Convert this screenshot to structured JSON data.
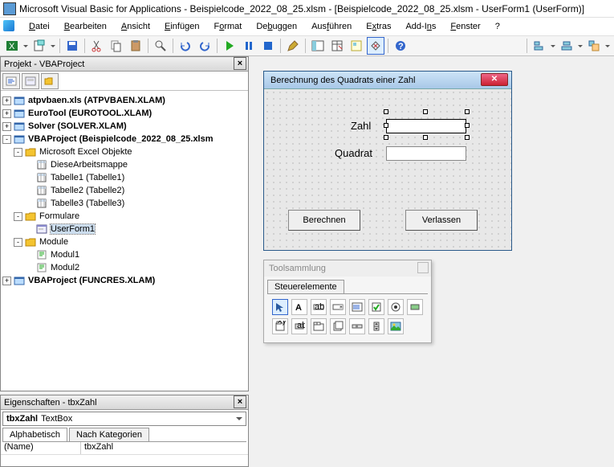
{
  "title": "Microsoft Visual Basic for Applications - Beispielcode_2022_08_25.xlsm - [Beispielcode_2022_08_25.xlsm - UserForm1 (UserForm)]",
  "menu": {
    "datei": "Datei",
    "bearbeiten": "Bearbeiten",
    "ansicht": "Ansicht",
    "einfuegen": "Einfügen",
    "format": "Format",
    "debuggen": "Debuggen",
    "ausfuehren": "Ausführen",
    "extras": "Extras",
    "addins": "Add-Ins",
    "fenster": "Fenster",
    "help": "?"
  },
  "project_panel": {
    "title": "Projekt - VBAProject",
    "items": [
      {
        "label": "atpvbaen.xls (ATPVBAEN.XLAM)",
        "bold": true,
        "exp": "+",
        "icon": "proj",
        "ind": 0
      },
      {
        "label": "EuroTool (EUROTOOL.XLAM)",
        "bold": true,
        "exp": "+",
        "icon": "proj",
        "ind": 0
      },
      {
        "label": "Solver (SOLVER.XLAM)",
        "bold": true,
        "exp": "+",
        "icon": "proj",
        "ind": 0
      },
      {
        "label": "VBAProject (Beispielcode_2022_08_25.xlsm",
        "bold": true,
        "exp": "-",
        "icon": "proj",
        "ind": 0
      },
      {
        "label": "Microsoft Excel Objekte",
        "bold": false,
        "exp": "-",
        "icon": "folder",
        "ind": 1
      },
      {
        "label": "DieseArbeitsmappe",
        "bold": false,
        "exp": "",
        "icon": "xls",
        "ind": 2
      },
      {
        "label": "Tabelle1 (Tabelle1)",
        "bold": false,
        "exp": "",
        "icon": "xls",
        "ind": 2
      },
      {
        "label": "Tabelle2 (Tabelle2)",
        "bold": false,
        "exp": "",
        "icon": "xls",
        "ind": 2
      },
      {
        "label": "Tabelle3 (Tabelle3)",
        "bold": false,
        "exp": "",
        "icon": "xls",
        "ind": 2
      },
      {
        "label": "Formulare",
        "bold": false,
        "exp": "-",
        "icon": "folder",
        "ind": 1
      },
      {
        "label": "UserForm1",
        "bold": false,
        "exp": "",
        "icon": "form",
        "ind": 2,
        "selected": true
      },
      {
        "label": "Module",
        "bold": false,
        "exp": "-",
        "icon": "folder",
        "ind": 1
      },
      {
        "label": "Modul1",
        "bold": false,
        "exp": "",
        "icon": "mod",
        "ind": 2
      },
      {
        "label": "Modul2",
        "bold": false,
        "exp": "",
        "icon": "mod",
        "ind": 2
      },
      {
        "label": "VBAProject (FUNCRES.XLAM)",
        "bold": true,
        "exp": "+",
        "icon": "proj",
        "ind": 0
      }
    ]
  },
  "props_panel": {
    "title": "Eigenschaften - tbxZahl",
    "combo": "tbxZahl TextBox",
    "tabs": {
      "alpha": "Alphabetisch",
      "kat": "Nach Kategorien"
    },
    "rows": [
      {
        "name": "(Name)",
        "val": "tbxZahl"
      }
    ]
  },
  "userform": {
    "title": "Berechnung des Quadrats einer Zahl",
    "label_zahl": "Zahl",
    "label_quadrat": "Quadrat",
    "btn_calc": "Berechnen",
    "btn_exit": "Verlassen"
  },
  "toolbox": {
    "title": "Toolsammlung",
    "tab": "Steuerelemente"
  }
}
